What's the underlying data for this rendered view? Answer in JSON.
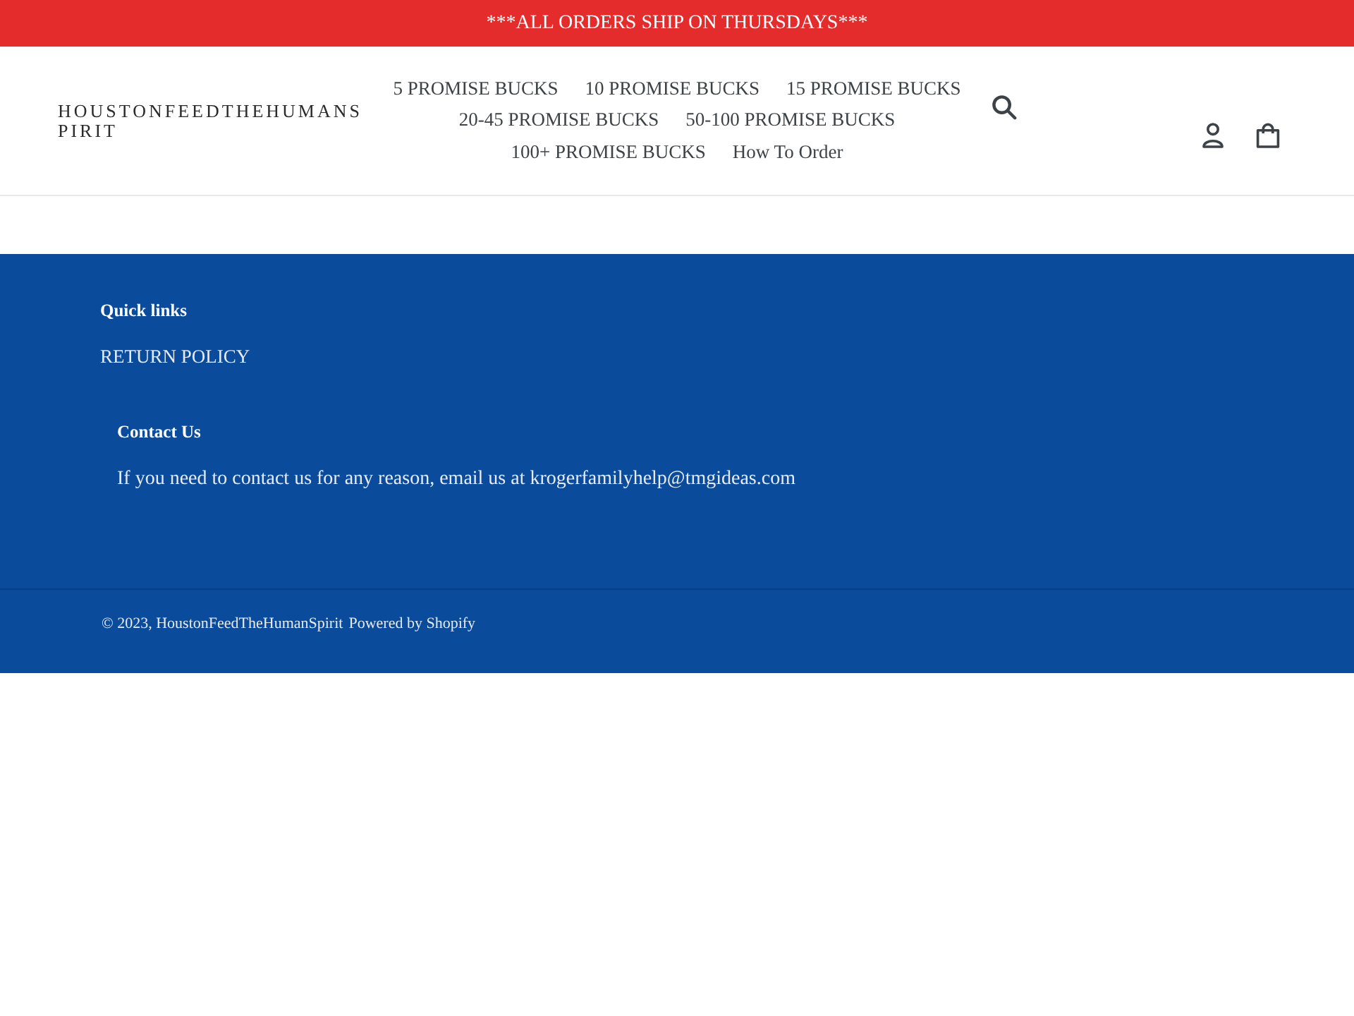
{
  "announcement": {
    "text": "***ALL ORDERS SHIP ON THURSDAYS***"
  },
  "header": {
    "logo": "HOUSTONFEEDTHEHUMANSPIRIT",
    "nav": [
      {
        "label": "5 PROMISE BUCKS"
      },
      {
        "label": "10 PROMISE BUCKS"
      },
      {
        "label": "15 PROMISE BUCKS"
      },
      {
        "label": "20-45 PROMISE BUCKS"
      },
      {
        "label": "50-100 PROMISE BUCKS"
      },
      {
        "label": "100+ PROMISE BUCKS"
      },
      {
        "label": "How To Order"
      }
    ]
  },
  "footer": {
    "quick_links": {
      "title": "Quick links",
      "links": [
        {
          "label": "RETURN POLICY"
        }
      ]
    },
    "contact": {
      "title": "Contact Us",
      "text": "If you need to contact us for any reason, email us at krogerfamilyhelp@tmgideas.com"
    },
    "copyright": "© 2023, HoustonFeedTheHumanSpirit",
    "powered_by": "Powered by Shopify"
  }
}
